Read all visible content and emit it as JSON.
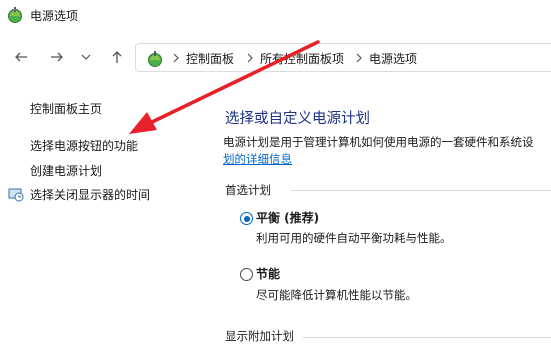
{
  "window": {
    "title": "电源选项"
  },
  "nav": {
    "breadcrumbs": [
      "控制面板",
      "所有控制面板项",
      "电源选项"
    ]
  },
  "sidebar": {
    "items": [
      {
        "label": "控制面板主页"
      },
      {
        "label": "选择电源按钮的功能"
      },
      {
        "label": "创建电源计划"
      },
      {
        "label": "选择关闭显示器的时间"
      }
    ]
  },
  "main": {
    "heading": "选择或自定义电源计划",
    "desc_line1": "电源计划是用于管理计算机如何使用电源的一套硬件和系统设",
    "desc_line2": "划的详细信息",
    "preferred_label": "首选计划",
    "plans": [
      {
        "name": "平衡 (推荐)",
        "desc": "利用可用的硬件自动平衡功耗与性能。",
        "selected": true
      },
      {
        "name": "节能",
        "desc": "尽可能降低计算机性能以节能。",
        "selected": false
      }
    ],
    "show_more_label": "显示附加计划"
  },
  "colors": {
    "heading": "#1e3287",
    "link": "#0066cc",
    "radio_selected": "#0067c0",
    "annotation_arrow": "#e8202a"
  }
}
